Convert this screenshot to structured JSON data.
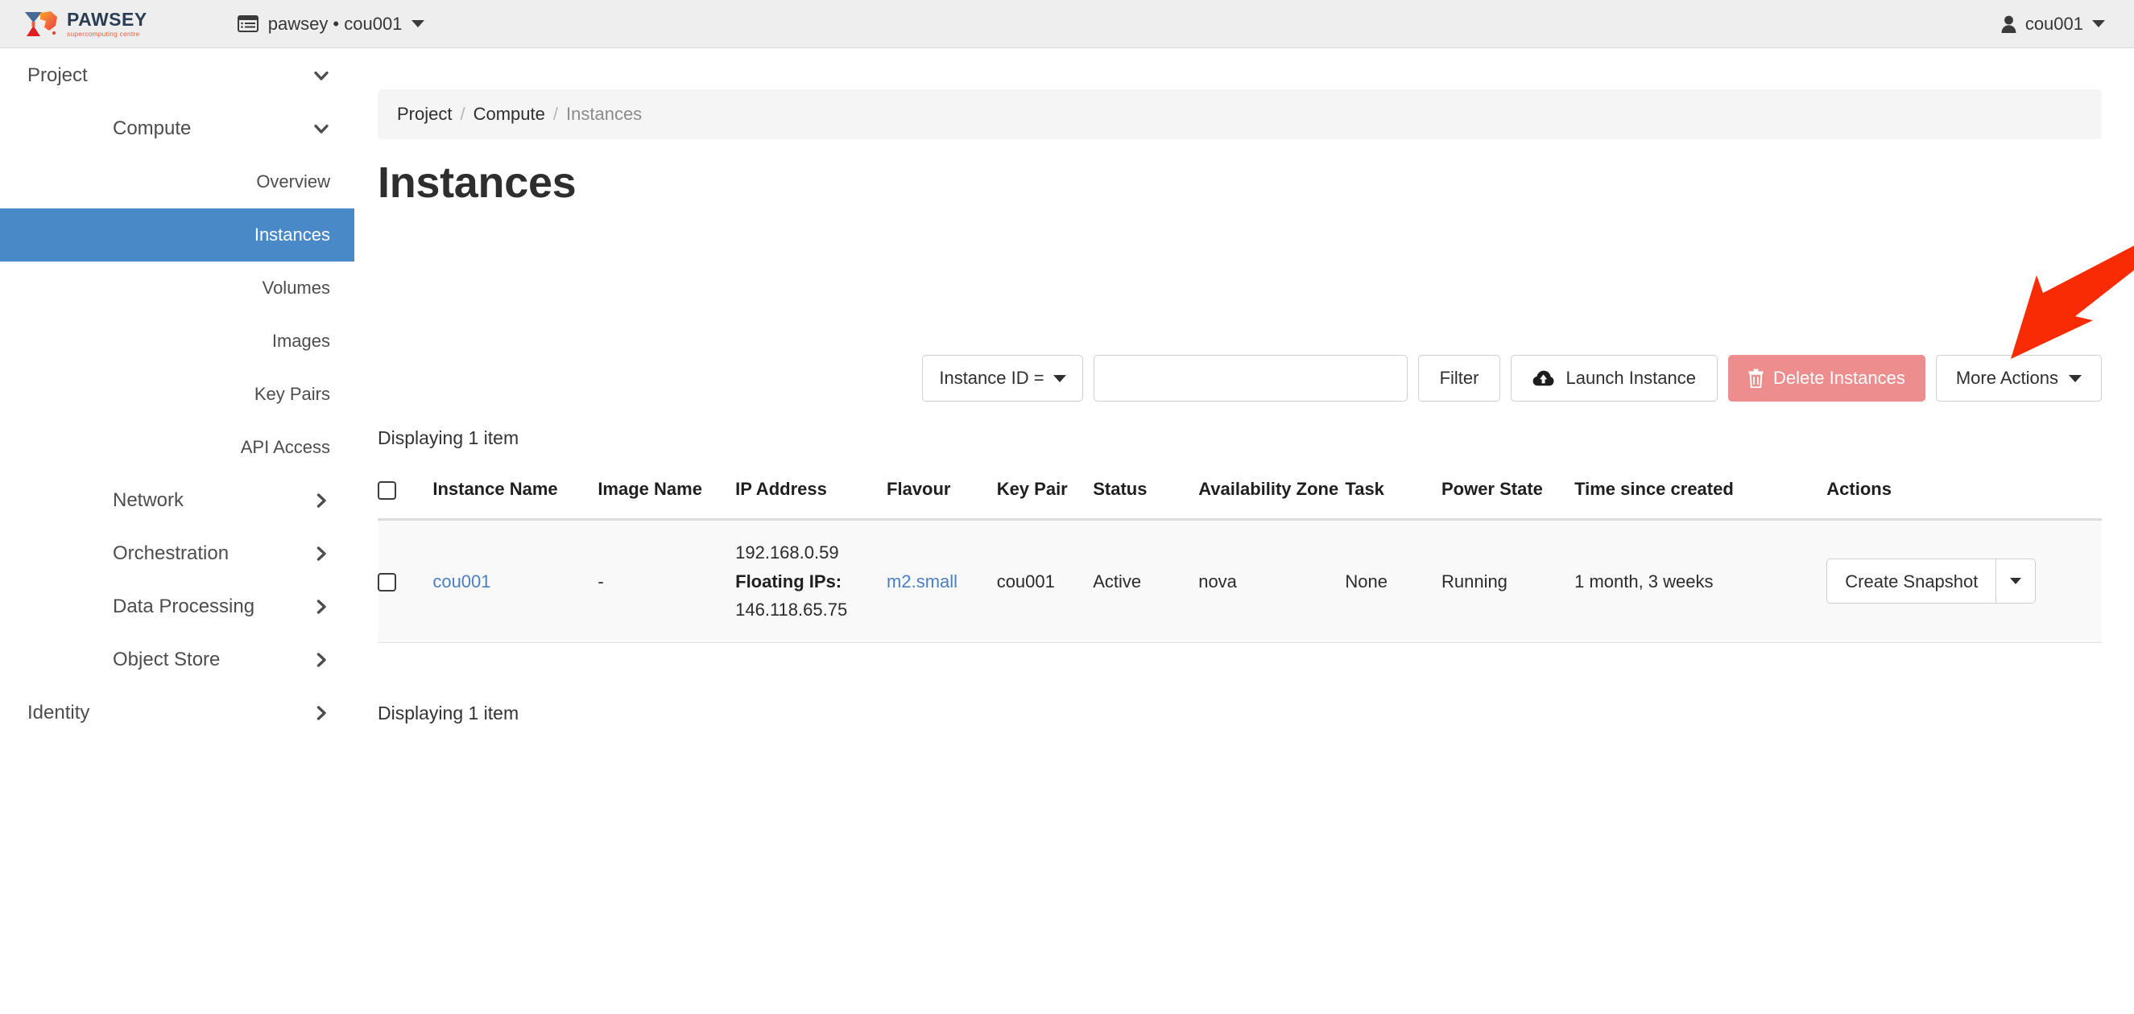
{
  "header": {
    "brand": {
      "name": "PAWSEY",
      "tagline": "supercomputing centre"
    },
    "project_switcher": {
      "label": "pawsey • cou001",
      "icon": "window-list-icon"
    },
    "user": {
      "name": "cou001",
      "icon": "person-icon"
    }
  },
  "sidebar": {
    "items": [
      {
        "label": "Project",
        "level": 0,
        "arrow": "chevron-down",
        "active": false
      },
      {
        "label": "Compute",
        "level": 1,
        "arrow": "chevron-down",
        "active": false
      },
      {
        "label": "Overview",
        "level": 2,
        "arrow": "",
        "active": false
      },
      {
        "label": "Instances",
        "level": 2,
        "arrow": "",
        "active": true
      },
      {
        "label": "Volumes",
        "level": 2,
        "arrow": "",
        "active": false
      },
      {
        "label": "Images",
        "level": 2,
        "arrow": "",
        "active": false
      },
      {
        "label": "Key Pairs",
        "level": 2,
        "arrow": "",
        "active": false
      },
      {
        "label": "API Access",
        "level": 2,
        "arrow": "",
        "active": false
      },
      {
        "label": "Network",
        "level": 1,
        "arrow": "chevron-right",
        "active": false
      },
      {
        "label": "Orchestration",
        "level": 1,
        "arrow": "chevron-right",
        "active": false
      },
      {
        "label": "Data Processing",
        "level": 1,
        "arrow": "chevron-right",
        "active": false
      },
      {
        "label": "Object Store",
        "level": 1,
        "arrow": "chevron-right",
        "active": false
      },
      {
        "label": "Identity",
        "level": 0,
        "arrow": "chevron-right",
        "active": false
      }
    ]
  },
  "breadcrumb": {
    "items": [
      "Project",
      "Compute",
      "Instances"
    ],
    "separator": "/"
  },
  "page": {
    "title": "Instances"
  },
  "toolbar": {
    "filter_type_label": "Instance ID =",
    "filter_input_value": "",
    "filter_input_placeholder": "",
    "filter_button": "Filter",
    "launch_button": "Launch Instance",
    "launch_icon": "cloud-upload-icon",
    "delete_button": "Delete Instances",
    "delete_icon": "trash-icon",
    "delete_color": "#ed8d8d",
    "more_actions_button": "More Actions"
  },
  "table": {
    "count_top": "Displaying 1 item",
    "count_bottom": "Displaying 1 item",
    "columns": [
      "",
      "Instance Name",
      "Image Name",
      "IP Address",
      "Flavour",
      "Key Pair",
      "Status",
      "Availability Zone",
      "Task",
      "Power State",
      "Time since created",
      "Actions"
    ],
    "rows": [
      {
        "selected": false,
        "instance_name": "cou001",
        "image_name": "-",
        "ip_primary": "192.168.0.59",
        "ip_floating_label": "Floating IPs:",
        "ip_floating": "146.118.65.75",
        "flavour": "m2.small",
        "key_pair": "cou001",
        "status": "Active",
        "availability_zone": "nova",
        "task": "None",
        "power_state": "Running",
        "time_since_created": "1 month, 3 weeks",
        "action_label": "Create Snapshot"
      }
    ]
  },
  "annotation": {
    "type": "arrow",
    "color": "#f92b05",
    "points_to": "launch-instance-button"
  },
  "colors": {
    "sidebar_active": "#4a89c8",
    "link": "#4b7fc4",
    "topbar_bg": "#eeeeee",
    "row_bg": "#f9f9f9",
    "brand_navy": "#2b3d55",
    "brand_orange": "#e8603c"
  }
}
